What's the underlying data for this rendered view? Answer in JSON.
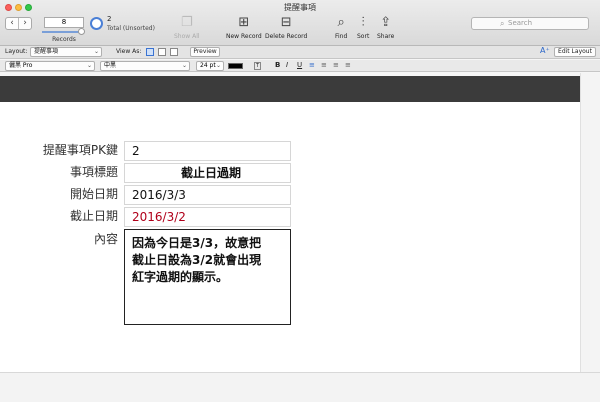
{
  "window": {
    "title": "提醒事項"
  },
  "toolbar": {
    "record_number": "8",
    "records_label": "Records",
    "found_count": "2",
    "total_label": "Total (Unsorted)",
    "show_all": "Show All",
    "new_record": "New Record",
    "delete_record": "Delete Record",
    "find": "Find",
    "sort": "Sort",
    "share": "Share",
    "search_placeholder": "Search"
  },
  "layout_bar": {
    "layout_label": "Layout:",
    "layout_value": "提醒事項",
    "view_as_label": "View As:",
    "preview_button": "Preview",
    "edit_layout_button": "Edit Layout"
  },
  "format_bar": {
    "font": "儷黑 Pro",
    "style": "中黑",
    "size": "24 pt",
    "bold": "B",
    "italic": "I",
    "underline": "U"
  },
  "form": {
    "pk_label": "提醒事項PK鍵",
    "pk_value": "2",
    "title_label": "事項標題",
    "title_value": "截止日過期",
    "start_label": "開始日期",
    "start_value": "2016/3/3",
    "due_label": "截止日期",
    "due_value": "2016/3/2",
    "content_label": "內容",
    "content_value": "因為今日是3/3，故意把\n截止日設為3/2就會出現\n紅字過期的顯示。"
  },
  "colors": {
    "overdue": "#b0001a",
    "header_part": "#3b3b3b",
    "accent": "#2a66c9"
  },
  "icons": [
    "chevron-left-icon",
    "chevron-right-icon",
    "pie-chart-icon",
    "show-all-icon",
    "new-record-icon",
    "delete-record-icon",
    "find-icon",
    "sort-icon",
    "share-icon",
    "search-icon",
    "text-size-icon"
  ]
}
